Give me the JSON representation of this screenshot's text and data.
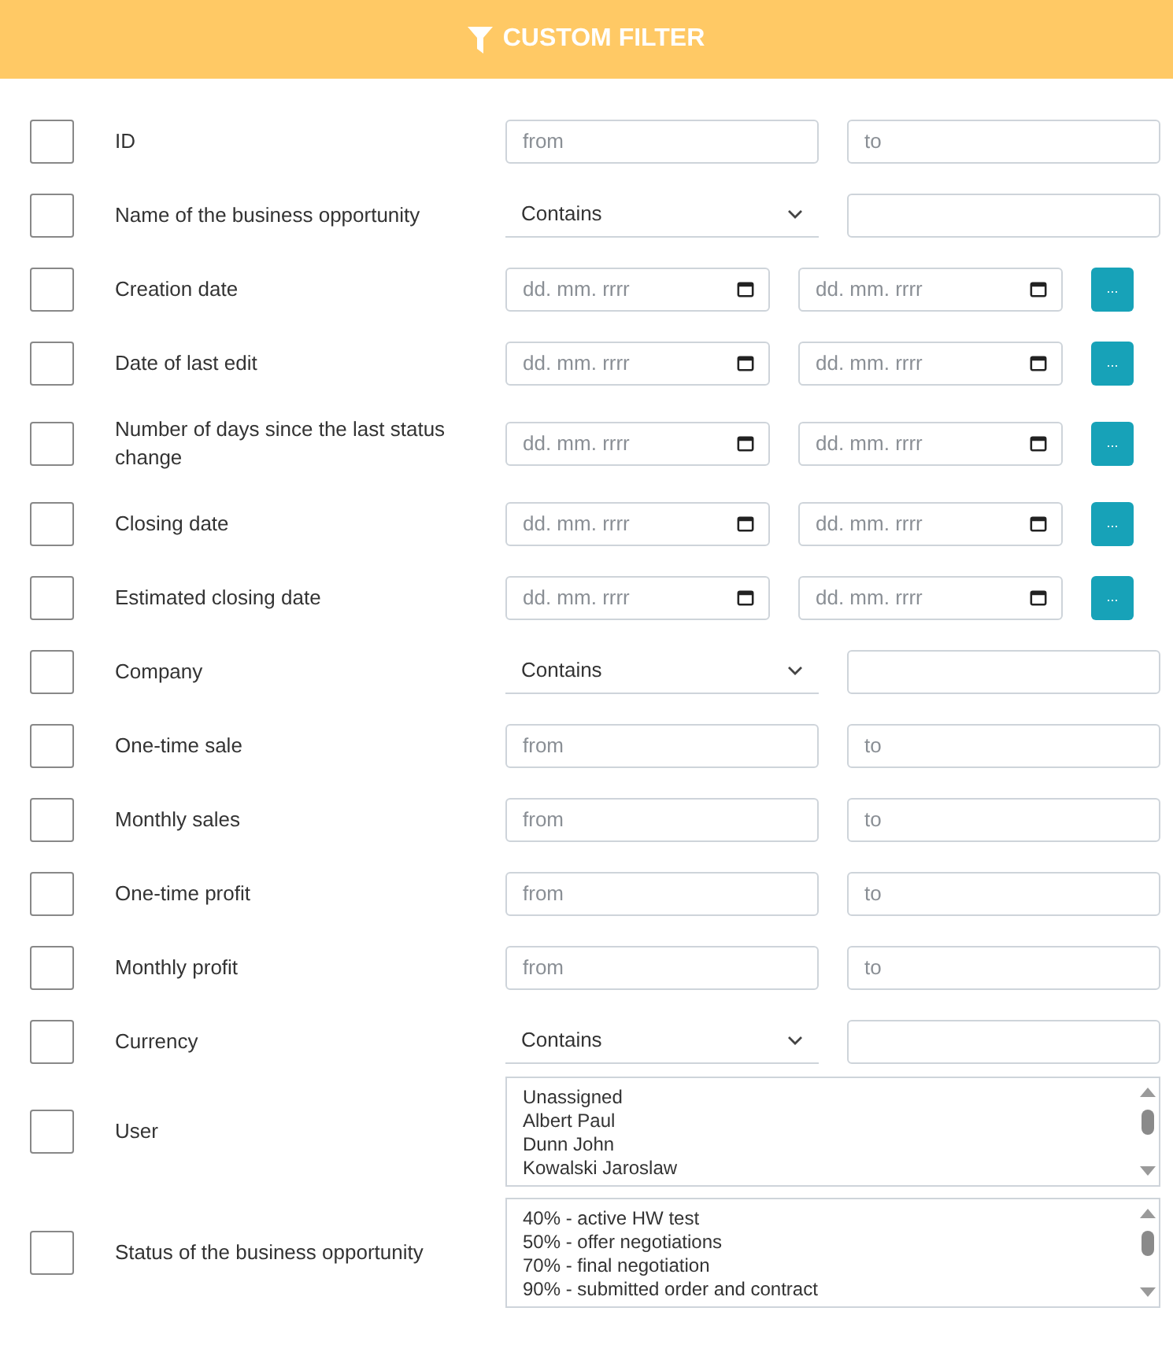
{
  "header": {
    "title": "CUSTOM FILTER"
  },
  "rows": [
    {
      "kind": "range",
      "label": "ID",
      "checked": false,
      "from_placeholder": "from",
      "to_placeholder": "to"
    },
    {
      "kind": "select",
      "label": "Name of the business opportunity",
      "checked": false,
      "operator": "Contains"
    },
    {
      "kind": "date",
      "label": "Creation date",
      "checked": false,
      "from_placeholder": "dd. mm. rrrr",
      "to_placeholder": "dd. mm. rrrr",
      "button": "..."
    },
    {
      "kind": "date",
      "label": "Date of last edit",
      "checked": false,
      "from_placeholder": "dd. mm. rrrr",
      "to_placeholder": "dd. mm. rrrr",
      "button": "..."
    },
    {
      "kind": "date",
      "label": "Number of days since the last status change",
      "checked": false,
      "from_placeholder": "dd. mm. rrrr",
      "to_placeholder": "dd. mm. rrrr",
      "button": "..."
    },
    {
      "kind": "date",
      "label": "Closing date",
      "checked": false,
      "from_placeholder": "dd. mm. rrrr",
      "to_placeholder": "dd. mm. rrrr",
      "button": "..."
    },
    {
      "kind": "date",
      "label": "Estimated closing date",
      "checked": false,
      "from_placeholder": "dd. mm. rrrr",
      "to_placeholder": "dd. mm. rrrr",
      "button": "..."
    },
    {
      "kind": "select",
      "label": "Company",
      "checked": false,
      "operator": "Contains"
    },
    {
      "kind": "range",
      "label": "One-time sale",
      "checked": false,
      "from_placeholder": "from",
      "to_placeholder": "to"
    },
    {
      "kind": "range",
      "label": "Monthly sales",
      "checked": false,
      "from_placeholder": "from",
      "to_placeholder": "to"
    },
    {
      "kind": "range",
      "label": "One-time profit",
      "checked": false,
      "from_placeholder": "from",
      "to_placeholder": "to"
    },
    {
      "kind": "range",
      "label": "Monthly profit",
      "checked": false,
      "from_placeholder": "from",
      "to_placeholder": "to"
    },
    {
      "kind": "select",
      "label": "Currency",
      "checked": false,
      "operator": "Contains"
    },
    {
      "kind": "list",
      "label": "User",
      "checked": false,
      "options": [
        "Unassigned",
        "Albert Paul",
        "Dunn John",
        "Kowalski Jaroslaw"
      ]
    },
    {
      "kind": "list",
      "label": "Status of the business opportunity",
      "checked": false,
      "options": [
        "40% - active HW test",
        "50% - offer negotiations",
        "70% - final negotiation",
        "90% - submitted order and contract"
      ]
    }
  ]
}
